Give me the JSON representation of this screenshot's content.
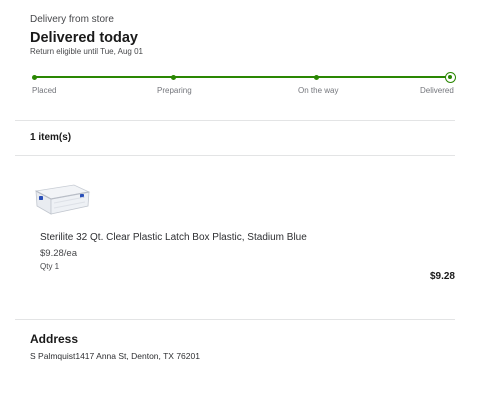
{
  "header": {
    "fulfillment_mode": "Delivery from store",
    "status_title": "Delivered today",
    "return_note": "Return eligible until Tue, Aug 01"
  },
  "tracker": {
    "color": "#2a8703",
    "steps": [
      {
        "label": "Placed"
      },
      {
        "label": "Preparing"
      },
      {
        "label": "On the way"
      },
      {
        "label": "Delivered"
      }
    ],
    "current_step": "Delivered"
  },
  "items_section": {
    "count_label": "1 item(s)",
    "items": [
      {
        "image_icon": "plastic-storage-box-image",
        "name": "Sterilite 32 Qt. Clear Plastic Latch Box Plastic, Stadium Blue",
        "unit_price": "$9.28/ea",
        "quantity": "Qty 1",
        "line_total": "$9.28"
      }
    ]
  },
  "address": {
    "heading": "Address",
    "line": "S Palmquist1417 Anna St, Denton, TX 76201"
  }
}
